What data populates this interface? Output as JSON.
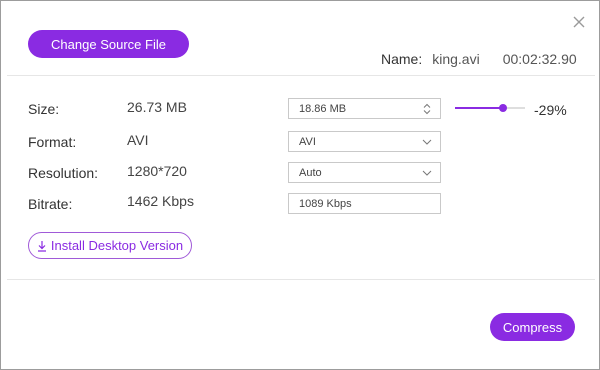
{
  "header": {
    "change_source_label": "Change Source File",
    "name_label": "Name:",
    "filename": "king.avi",
    "duration": "00:02:32.90"
  },
  "fields": {
    "size": {
      "label": "Size:",
      "value": "26.73 MB",
      "control_value": "18.86  MB"
    },
    "format": {
      "label": "Format:",
      "value": "AVI",
      "selected": "AVI"
    },
    "resolution": {
      "label": "Resolution:",
      "value": "1280*720",
      "selected": "Auto"
    },
    "bitrate": {
      "label": "Bitrate:",
      "value": "1462  Kbps",
      "control_value": "1089 Kbps"
    }
  },
  "slider": {
    "level_fraction": 0.68,
    "percent_label": "-29%"
  },
  "install_label": "Install Desktop Version",
  "compress_label": "Compress",
  "icons": {
    "close": "close-icon",
    "spinner": "updown-stepper-icon",
    "dropdown": "chevron-down-icon",
    "download": "download-icon"
  },
  "colors": {
    "accent": "#8a2be2",
    "divider": "#e6e6e6"
  }
}
